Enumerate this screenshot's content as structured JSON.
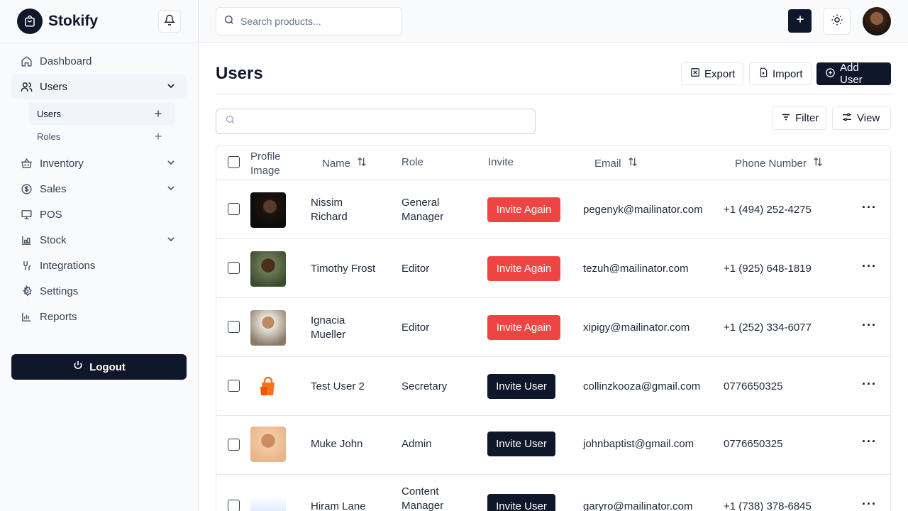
{
  "app": {
    "name": "Stokify"
  },
  "topbar": {
    "search_placeholder": "Search products..."
  },
  "sidebar": {
    "items": [
      {
        "label": "Dashboard",
        "icon": "home-icon"
      },
      {
        "label": "Users",
        "icon": "users-icon",
        "expanded": true
      },
      {
        "label": "Inventory",
        "icon": "basket-icon"
      },
      {
        "label": "Sales",
        "icon": "dollar-icon"
      },
      {
        "label": "POS",
        "icon": "monitor-icon"
      },
      {
        "label": "Stock",
        "icon": "stock-icon"
      },
      {
        "label": "Integrations",
        "icon": "integrations-icon"
      },
      {
        "label": "Settings",
        "icon": "gear-icon"
      },
      {
        "label": "Reports",
        "icon": "chart-icon"
      }
    ],
    "subitems": [
      {
        "label": "Users"
      },
      {
        "label": "Roles"
      }
    ],
    "logout_label": "Logout"
  },
  "main": {
    "title": "Users",
    "export_label": "Export",
    "import_label": "Import",
    "add_user_label": "Add User",
    "filter_label": "Filter",
    "view_label": "View",
    "table_search_placeholder": ""
  },
  "table": {
    "headers": {
      "profile_image": "Profile Image",
      "name": "Name",
      "role": "Role",
      "invite": "Invite",
      "email": "Email",
      "phone": "Phone Number"
    },
    "rows": [
      {
        "name": "Nissim Richard",
        "role": "General Manager",
        "invite": "Invite Again",
        "email": "pegenyk@mailinator.com",
        "phone": "+1 (494) 252-4275"
      },
      {
        "name": "Timothy Frost",
        "role": "Editor",
        "invite": "Invite Again",
        "email": "tezuh@mailinator.com",
        "phone": "+1 (925) 648-1819"
      },
      {
        "name": "Ignacia Mueller",
        "role": "Editor",
        "invite": "Invite Again",
        "email": "xipigy@mailinator.com",
        "phone": "+1 (252) 334-6077"
      },
      {
        "name": "Test User 2",
        "role": "Secretary",
        "invite": "Invite User",
        "email": "collinzkooza@gmail.com",
        "phone": "0776650325"
      },
      {
        "name": "Muke John",
        "role": "Admin",
        "invite": "Invite User",
        "email": "johnbaptist@gmail.com",
        "phone": "0776650325"
      },
      {
        "name": "Hiram Lane",
        "role": "Content Manager",
        "invite": "Invite User",
        "email": "garyro@mailinator.com",
        "phone": "+1 (738) 378-6845"
      }
    ]
  },
  "colors": {
    "primary": "#0f172a",
    "danger": "#ef4444",
    "border": "#e5e7eb",
    "sidebar_bg": "#f8fafc"
  }
}
